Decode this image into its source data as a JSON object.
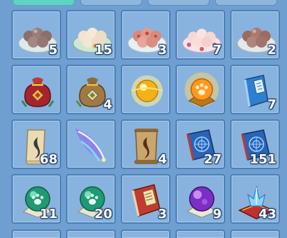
{
  "theme": {
    "background": "#6e9fd0",
    "slot": "#88b3de",
    "slot_border": "#4c7fb6",
    "active_tab": "#5fd4c6"
  },
  "tabs": [
    {
      "name": "tab-1",
      "active": true
    },
    {
      "name": "tab-2",
      "active": false
    },
    {
      "name": "tab-3",
      "active": false
    },
    {
      "name": "tab-4",
      "active": false
    }
  ],
  "inventory": {
    "items": [
      {
        "icon": "dumpling-plate-dark-icon",
        "count": "5"
      },
      {
        "icon": "dumpling-plate-white-icon",
        "count": "15"
      },
      {
        "icon": "dumpling-plate-red-icon",
        "count": "3"
      },
      {
        "icon": "dumpling-plate-pink-icon",
        "count": "7"
      },
      {
        "icon": "dumpling-plate-brown-icon",
        "count": "2"
      },
      {
        "icon": "red-lucky-bag-icon",
        "count": ""
      },
      {
        "icon": "brown-lucky-bag-icon",
        "count": "4"
      },
      {
        "icon": "golden-orb-icon",
        "count": ""
      },
      {
        "icon": "paw-orb-icon",
        "count": ""
      },
      {
        "icon": "blue-book-icon",
        "count": "7"
      },
      {
        "icon": "scroll-small-icon",
        "count": "68"
      },
      {
        "icon": "feather-icon",
        "count": ""
      },
      {
        "icon": "scroll-large-icon",
        "count": "4"
      },
      {
        "icon": "skill-book-icon",
        "count": "27"
      },
      {
        "icon": "skill-book-icon",
        "count": "151"
      },
      {
        "icon": "green-paw-orb-icon",
        "count": "11"
      },
      {
        "icon": "green-paw-orb-icon",
        "count": "20"
      },
      {
        "icon": "red-book-icon",
        "count": "3"
      },
      {
        "icon": "purple-orb-icon",
        "count": "9"
      },
      {
        "icon": "crystal-cushion-icon",
        "count": "43"
      }
    ]
  }
}
